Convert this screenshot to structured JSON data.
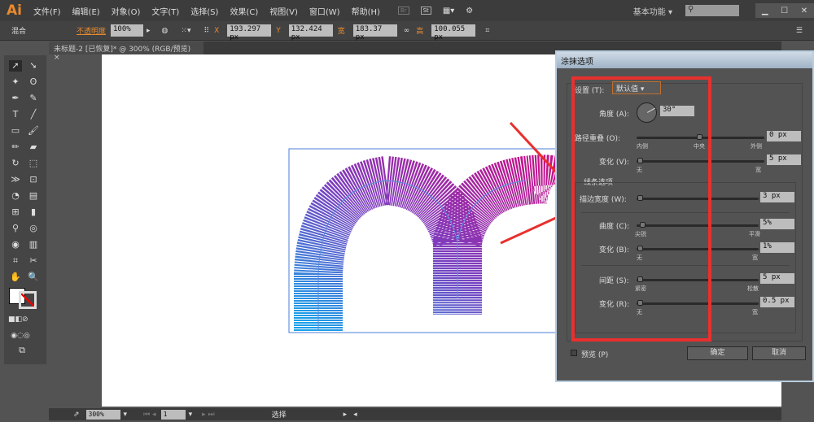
{
  "app": {
    "logo": "Ai",
    "menus": [
      "文件(F)",
      "编辑(E)",
      "对象(O)",
      "文字(T)",
      "选择(S)",
      "效果(C)",
      "视图(V)",
      "窗口(W)",
      "帮助(H)"
    ],
    "workspace": "基本功能",
    "badges": [
      "Br",
      "St"
    ]
  },
  "control": {
    "mode": "混合",
    "opacity_label": "不透明度",
    "opacity": "100%",
    "x_label": "X",
    "x": "193.297 px",
    "y_label": "Y",
    "y": "132.424 px",
    "w_label": "宽",
    "w": "183.37 px",
    "h_label": "高",
    "h": "100.055 px"
  },
  "document": {
    "tab": "未标题-2 [已恢复]* @ 300% (RGB/预览)"
  },
  "status": {
    "zoom": "300%",
    "page": "1",
    "tool": "选择"
  },
  "dialog": {
    "title": "涂抹选项",
    "settings_label": "设置 (T):",
    "settings_value": "默认值",
    "angle_label": "角度 (A):",
    "angle": "30°",
    "angle_deg": 30,
    "overlap_label": "路径重叠 (O):",
    "overlap": "0 px",
    "overlap_ticks": [
      "内侧",
      "中央",
      "外侧"
    ],
    "var1_label": "变化 (V):",
    "var1": "5 px",
    "none": "无",
    "wide": "宽",
    "line_options": "线条选项",
    "stroke_label": "描边宽度 (W):",
    "stroke": "3 px",
    "curve_label": "曲度 (C):",
    "curve": "5%",
    "curve_ticks": [
      "尖锐",
      "平滑"
    ],
    "var2_label": "变化 (B):",
    "var2": "1%",
    "spacing_label": "间距 (S):",
    "spacing": "5 px",
    "spacing_ticks": [
      "紧密",
      "松散"
    ],
    "var3_label": "变化 (R):",
    "var3": "0.5 px",
    "preview_label": "预览 (P)",
    "ok": "确定",
    "cancel": "取消"
  },
  "colors": {
    "highlight": "#e8302e",
    "grad_start": "#1aa0e8",
    "grad_mid": "#7a3fc0",
    "grad_end": "#c0158c"
  }
}
